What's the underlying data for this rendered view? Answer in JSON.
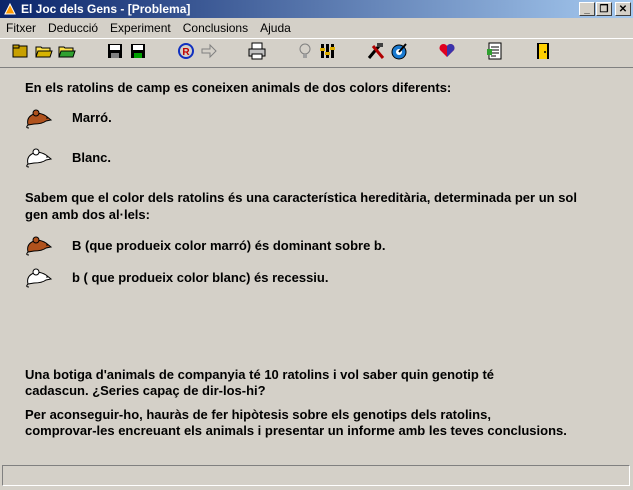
{
  "window": {
    "title": "El Joc dels Gens - [Problema]",
    "buttons": {
      "minimize": "_",
      "restore": "❐",
      "close": "✕"
    }
  },
  "menubar": {
    "items": [
      {
        "label": "Fitxer"
      },
      {
        "label": "Deducció"
      },
      {
        "label": "Experiment"
      },
      {
        "label": "Conclusions"
      },
      {
        "label": "Ajuda"
      }
    ]
  },
  "toolbar": {
    "buttons": [
      {
        "icon": "new-icon"
      },
      {
        "icon": "open-icon"
      },
      {
        "icon": "open-folder-icon"
      },
      {
        "icon": "save-icon"
      },
      {
        "icon": "save-as-icon"
      },
      {
        "icon": "refresh-icon"
      },
      {
        "icon": "forward-arrow-icon"
      },
      {
        "icon": "print-icon"
      },
      {
        "icon": "lightbulb-icon"
      },
      {
        "icon": "settings-icon"
      },
      {
        "icon": "tools-icon"
      },
      {
        "icon": "target-icon"
      },
      {
        "icon": "heart-icon"
      },
      {
        "icon": "report-icon"
      },
      {
        "icon": "exit-door-icon"
      }
    ]
  },
  "content": {
    "intro": "En els ratolins de camp es coneixen animals de dos colors diferents:",
    "brown_label": "Marró.",
    "white_label": "Blanc.",
    "heredity_line1": "Sabem que el color dels ratolins és una característica hereditària, determinada per un sol",
    "heredity_line2": "gen amb dos al·lels:",
    "allele_B": "B (que produeix color marró) és dominant sobre b.",
    "allele_b": "b ( que produeix color blanc) és recessiu.",
    "shop_line1": "Una botiga d'animals de companyia té 10 ratolins i vol saber quin genotip té",
    "shop_line2": "cadascun. ¿Series capaç de dir-los-hi?",
    "task_line1": "Per aconseguir-ho, hauràs de fer hipòtesis sobre els genotips dels ratolins,",
    "task_line2": "comprovar-les encreuant els animals i presentar un informe amb les teves conclusions."
  },
  "colors": {
    "brown_mouse": "#b0521d",
    "white_mouse": "#ffffff"
  }
}
